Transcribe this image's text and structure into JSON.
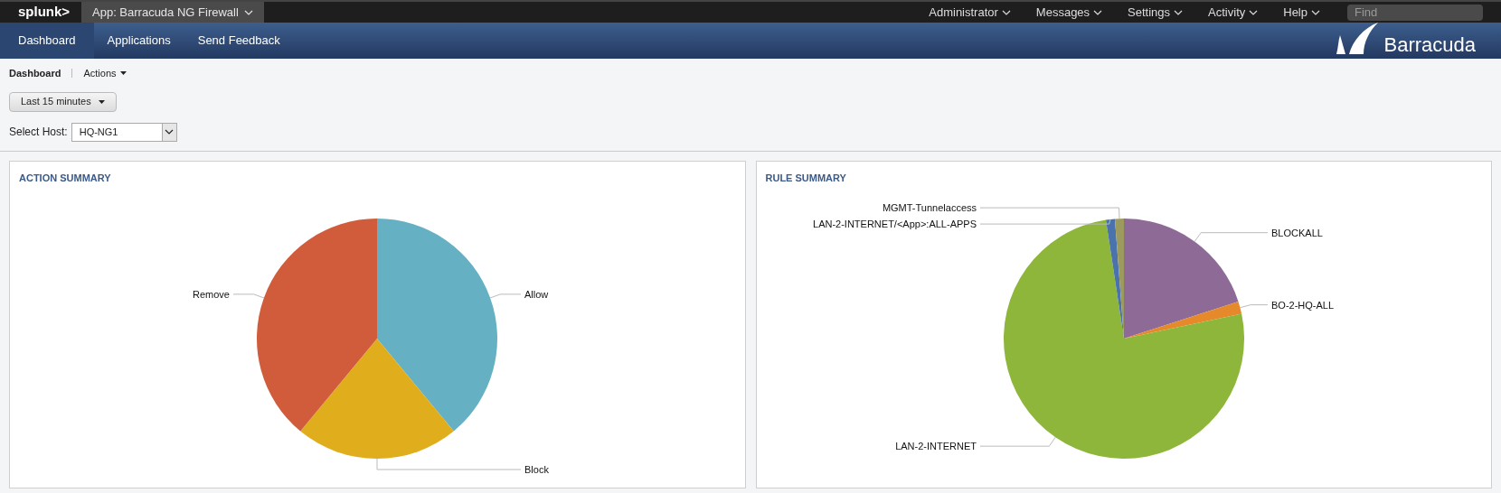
{
  "top_bar": {
    "logo": "splunk>",
    "app_menu": "App: Barracuda NG Firewall",
    "menus": [
      "Administrator",
      "Messages",
      "Settings",
      "Activity",
      "Help"
    ],
    "search": {
      "placeholder": "Find"
    }
  },
  "nav": {
    "tabs": [
      {
        "label": "Dashboard",
        "selected": true
      },
      {
        "label": "Applications",
        "selected": false
      },
      {
        "label": "Send Feedback",
        "selected": false
      }
    ],
    "brand": "Barracuda"
  },
  "breadcrumb": {
    "title": "Dashboard",
    "actions": "Actions"
  },
  "time_picker": "Last 15 minutes",
  "host_select": {
    "label": "Select Host:",
    "value": "HQ-NG1"
  },
  "panels": [
    {
      "title": "ACTION SUMMARY",
      "chart_data": {
        "type": "pie",
        "categories": [
          "Allow",
          "Block",
          "Remove"
        ],
        "values": [
          39,
          22,
          39
        ],
        "colors": [
          "#66b0c4",
          "#e0ae1c",
          "#d15c3b"
        ]
      }
    },
    {
      "title": "RULE SUMMARY",
      "chart_data": {
        "type": "pie",
        "categories": [
          "BLOCKALL",
          "BO-2-HQ-ALL",
          "LAN-2-INTERNET",
          "LAN-2-INTERNET/<App>:ALL-APPS",
          "MGMT-Tunnelaccess"
        ],
        "values": [
          20,
          1.7,
          75.9,
          1.2,
          1.2
        ],
        "colors": [
          "#8e6a96",
          "#e6892a",
          "#8db63a",
          "#4a73ad",
          "#9c9a5c"
        ]
      }
    }
  ]
}
